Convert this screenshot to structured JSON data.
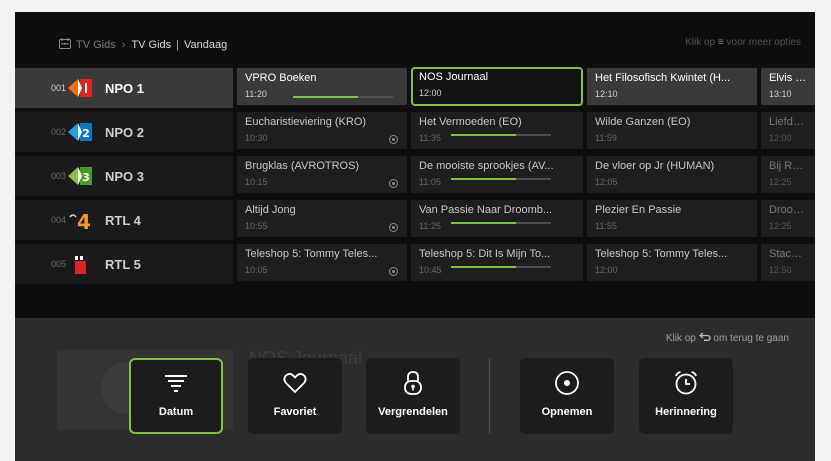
{
  "breadcrumb": {
    "root": "TV Gids",
    "section": "TV Gids",
    "current": "Vandaag"
  },
  "top_hint": {
    "prefix": "Klik op",
    "key_icon": "menu-lines-icon",
    "suffix": "voor meer opties"
  },
  "channels": [
    {
      "number": "001",
      "name": "NPO 1",
      "logo": "npo1-logo"
    },
    {
      "number": "002",
      "name": "NPO 2",
      "logo": "npo2-logo"
    },
    {
      "number": "003",
      "name": "NPO 3",
      "logo": "npo3-logo"
    },
    {
      "number": "004",
      "name": "RTL 4",
      "logo": "rtl4-logo"
    },
    {
      "number": "005",
      "name": "RTL 5",
      "logo": "rtl5-logo"
    }
  ],
  "programs": [
    [
      {
        "title": "VPRO Boeken",
        "time": "11:20",
        "progress": 0.65
      },
      {
        "title": "NOS Journaal",
        "time": "12:00"
      },
      {
        "title": "Het Filosofisch Kwintet (H...",
        "time": "12:10"
      },
      {
        "title": "Elvis Live",
        "time": "13:10"
      }
    ],
    [
      {
        "title": "Eucharistieviering (KRO)",
        "time": "10:30",
        "record": true
      },
      {
        "title": "Het Vermoeden (EO)",
        "time": "11:35",
        "progress": 0.65
      },
      {
        "title": "Wilde Ganzen (EO)",
        "time": "11:59"
      },
      {
        "title": "Liefde in",
        "time": "12:00"
      }
    ],
    [
      {
        "title": "Brugklas (AVROTROS)",
        "time": "10:15",
        "record": true
      },
      {
        "title": "De mooiste sprookjes (AV...",
        "time": "11:05",
        "progress": 0.65
      },
      {
        "title": "De vloer op Jr (HUMAN)",
        "time": "12:05"
      },
      {
        "title": "Bij Ron in",
        "time": "12:25"
      }
    ],
    [
      {
        "title": "Altijd Jong",
        "time": "10:55",
        "record": true
      },
      {
        "title": "Van Passie Naar Droomb...",
        "time": "11:25",
        "progress": 0.65
      },
      {
        "title": "Plezier En Passie",
        "time": "11:55"
      },
      {
        "title": "Droom V",
        "time": "12:25"
      }
    ],
    [
      {
        "title": "Teleshop 5: Tommy Teles...",
        "time": "10:05",
        "record": true
      },
      {
        "title": "Teleshop 5: Dit Is Mijn To...",
        "time": "10:45",
        "progress": 0.65
      },
      {
        "title": "Teleshop 5: Tommy Teles...",
        "time": "12:00"
      },
      {
        "title": "Stacey D",
        "time": "12:50"
      }
    ]
  ],
  "overlay": {
    "hint": {
      "prefix": "Klik op",
      "key_icon": "back-arrow-icon",
      "suffix": "om terug te gaan"
    },
    "background_title": "NOS Journaal",
    "buttons": [
      {
        "label": "Datum",
        "icon": "filter-lines-icon",
        "active": true
      },
      {
        "label": "Favoriet",
        "icon": "heart-icon"
      },
      {
        "label": "Vergrendelen",
        "icon": "lock-icon"
      },
      {
        "label": "Opnemen",
        "icon": "record-icon"
      },
      {
        "label": "Herinnering",
        "icon": "alarm-clock-icon"
      }
    ]
  },
  "colors": {
    "accent": "#84c341",
    "background": "#0e0e0e",
    "overlay": "#2c2c2c",
    "selected_row": "#3a3a3a"
  }
}
